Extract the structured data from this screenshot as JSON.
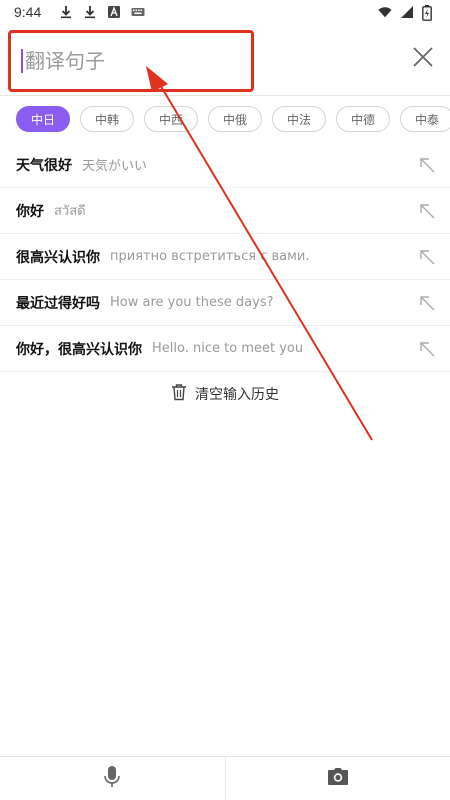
{
  "status_bar": {
    "time": "9:44",
    "left_icons": [
      "download-icon",
      "download-icon",
      "font-icon",
      "keyboard-icon"
    ],
    "right_icons": [
      "wifi-icon",
      "signal-icon",
      "battery-charging-icon"
    ]
  },
  "search": {
    "placeholder": "翻译句子",
    "value": "",
    "close_icon": "close-icon"
  },
  "languages": [
    {
      "label": "中日",
      "active": true
    },
    {
      "label": "中韩",
      "active": false
    },
    {
      "label": "中西",
      "active": false
    },
    {
      "label": "中俄",
      "active": false
    },
    {
      "label": "中法",
      "active": false
    },
    {
      "label": "中德",
      "active": false
    },
    {
      "label": "中泰",
      "active": false
    }
  ],
  "history": [
    {
      "source": "天气很好",
      "target": "天気がいい"
    },
    {
      "source": "你好",
      "target": "สวัสดี"
    },
    {
      "source": "很高兴认识你",
      "target": "приятно встретиться с вами."
    },
    {
      "source": "最近过得好吗",
      "target": "How are you these days?"
    },
    {
      "source": "你好，很高兴认识你",
      "target": "Hello. nice to meet you"
    }
  ],
  "clear_history": {
    "label": "清空输入历史",
    "icon": "trash-icon"
  },
  "bottom_bar": {
    "left_icon": "microphone-icon",
    "right_icon": "camera-icon"
  },
  "colors": {
    "accent": "#8a5cf0",
    "annotation": "#e0301e"
  }
}
